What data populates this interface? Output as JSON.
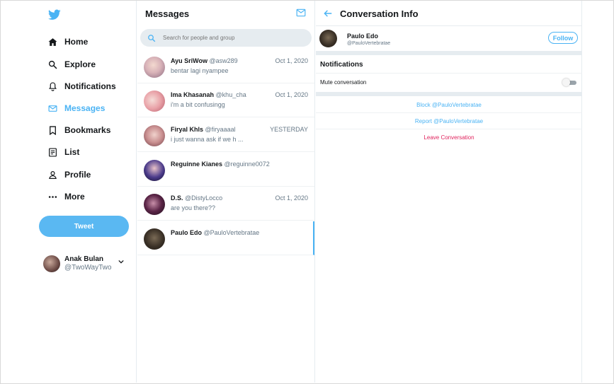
{
  "sidebar": {
    "logo_icon": "twitter-bird-icon",
    "items": [
      {
        "label": "Home",
        "icon": "home-icon"
      },
      {
        "label": "Explore",
        "icon": "search-icon"
      },
      {
        "label": "Notifications",
        "icon": "bell-icon"
      },
      {
        "label": "Messages",
        "icon": "envelope-icon",
        "active": true
      },
      {
        "label": "Bookmarks",
        "icon": "bookmark-icon"
      },
      {
        "label": "List",
        "icon": "list-icon"
      },
      {
        "label": "Profile",
        "icon": "person-icon"
      },
      {
        "label": "More",
        "icon": "more-dots-icon"
      }
    ],
    "tweet_label": "Tweet",
    "account": {
      "name": "Anak Bulan",
      "handle": "@TwoWayTwo"
    }
  },
  "messages": {
    "title": "Messages",
    "search_placeholder": "Search for people and group",
    "conversations": [
      {
        "name": "Ayu SriWow",
        "handle": "@asw289",
        "date": "Oct 1, 2020",
        "preview": "bentar lagi nyampee"
      },
      {
        "name": "Ima Khasanah",
        "handle": "@khu_cha",
        "date": "Oct 1, 2020",
        "preview": "i'm a bit confusingg"
      },
      {
        "name": "Firyal Khls",
        "handle": "@firyaaaal",
        "date": "YESTERDAY",
        "preview": "i just wanna ask if we h ..."
      },
      {
        "name": "Reguinne Kianes",
        "handle": "@reguinne0072",
        "date": "",
        "preview": ""
      },
      {
        "name": "D.S.",
        "handle": "@DistyLocco",
        "date": "Oct 1, 2020",
        "preview": "are you there??"
      },
      {
        "name": "Paulo Edo",
        "handle": "@PauloVertebratae",
        "date": "",
        "preview": "",
        "selected": true
      }
    ]
  },
  "info": {
    "title": "Conversation Info",
    "user": {
      "name": "Paulo Edo",
      "handle": "@PauloVertebratae"
    },
    "follow_label": "Follow",
    "notifications_title": "Notifications",
    "mute_label": "Mute conversation",
    "mute_on": false,
    "block_label": "Block @PauloVertebratae",
    "report_label": "Report @PauloVertebratae",
    "leave_label": "Leave Conversation"
  },
  "colors": {
    "accent": "#4ab3f4",
    "danger": "#e0245e",
    "tweet_button": "#5ab8f2"
  }
}
